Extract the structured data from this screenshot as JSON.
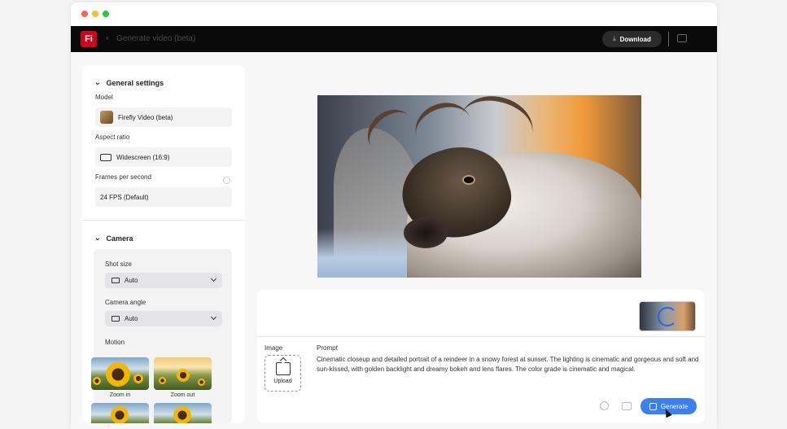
{
  "app": {
    "logo_text": "Fi",
    "title": "Generate video (beta)",
    "download_label": "Download"
  },
  "sidebar": {
    "general_settings": {
      "heading": "General settings",
      "model_label": "Model",
      "model_value": "Firefly Video (beta)",
      "aspect_label": "Aspect ratio",
      "aspect_value": "Widescreen (16:9)",
      "fps_label": "Frames per second",
      "fps_value": "24 FPS (Default)"
    },
    "camera": {
      "heading": "Camera",
      "shot_size_label": "Shot size",
      "shot_size_value": "Auto",
      "angle_label": "Camera angle",
      "angle_value": "Auto",
      "motion_label": "Motion",
      "motion_options": [
        {
          "caption": "Zoom in"
        },
        {
          "caption": "Zoom out"
        }
      ]
    }
  },
  "prompt_panel": {
    "image_label": "Image",
    "upload_label": "Upload",
    "prompt_label": "Prompt",
    "prompt_text": "Cinematic closeup and detailed portrait of a reindeer in a snowy forest at sunset. The lighting is cinematic and gorgeous and soft and sun-kissed, with golden backlight and dreamy bokeh and lens flares. The color grade is cinematic and magical.",
    "generate_label": "Generate"
  },
  "colors": {
    "accent": "#3b7ff0",
    "logo": "#d0021b",
    "appbar": "#0a0a0a"
  }
}
